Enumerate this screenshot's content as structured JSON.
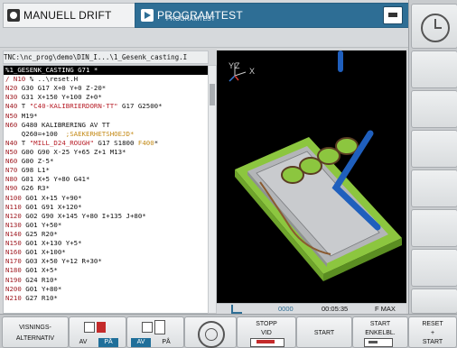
{
  "header": {
    "mode_left": "MANUELL DRIFT",
    "mode_right": "PROGRAMTEST",
    "mode_right_sub": "PROGRAMTEST"
  },
  "path": "TNC:\\nc_prog\\demo\\DIN_I...\\1_Gesenk_casting.I",
  "program": [
    "%1_GESENK_CASTING G71 *",
    "/ N10 % ..\\reset.H",
    "N20 G30 G17 X+0 Y+0 Z-20*",
    "N30 G31 X+150 Y+100 Z+0*",
    "N40 T \"C40-KALIBRIERDORN-TT\" G17 G2500*",
    "N50 M19*",
    "N60 G480 KALIBRERING AV TT",
    "    Q260=+100  ;SAEKERHETSHOEJD*",
    "N40 T \"MILL_D24_ROUGH\" G17 S1800 F400*",
    "N50 G00 G90 X-25 Y+65 Z+1 M13*",
    "N60 G00 Z-5*",
    "N70 G98 L1*",
    "N80 G01 X+5 Y+80 G41*",
    "N90 G26 R3*",
    "N100 G01 X+15 Y+90*",
    "N110 G01 G91 X+120*",
    "N120 G02 G90 X+145 Y+80 I+135 J+80*",
    "N130 G01 Y+50*",
    "N140 G25 R20*",
    "N150 G01 X+130 Y+5*",
    "N160 G01 X+100*",
    "N170 G03 X+50 Y+12 R+30*",
    "N180 G01 X+5*",
    "N190 G24 R10*",
    "N200 G01 Y+80*",
    "N210 G27 R10*"
  ],
  "graphic": {
    "axis_label": "Y",
    "axis_label_z": "Z",
    "axis_label_x": "X"
  },
  "status": {
    "dots": "0000",
    "time": "00:05:35",
    "feed": "F MAX"
  },
  "softkeys": {
    "visning_1": "VISNINGS-",
    "visning_2": "ALTERNATIV",
    "toggle_av": "AV",
    "toggle_pa": "PÅ",
    "stopp_1": "STOPP",
    "stopp_2": "VID",
    "start": "START",
    "start_enkel_1": "START",
    "start_enkel_2": "ENKELBL.",
    "reset_1": "RESET",
    "reset_2": "+",
    "reset_3": "START"
  },
  "colors": {
    "accent": "#2e6e95",
    "workpiece_top": "#b3b5b8",
    "base": "#8cc63f",
    "toolpath": "#1f5fbd"
  }
}
